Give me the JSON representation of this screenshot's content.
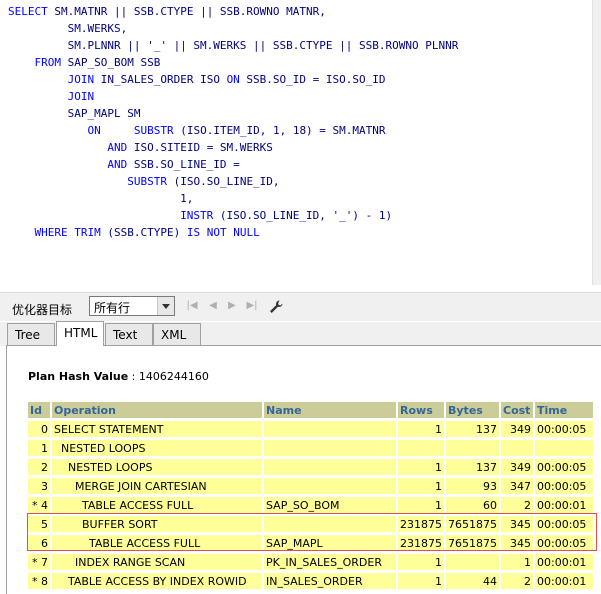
{
  "sql": {
    "lines": [
      {
        "segments": [
          {
            "t": "SELECT",
            "c": "kw"
          },
          {
            "t": " SM.MATNR || SSB.CTYPE || SSB.ROWNO MATNR,",
            "c": "lit"
          }
        ]
      },
      {
        "segments": [
          {
            "t": "         SM.WERKS,",
            "c": "lit"
          }
        ]
      },
      {
        "segments": [
          {
            "t": "         SM.PLNNR || '_' || SM.WERKS || SSB.CTYPE || SSB.ROWNO PLNNR",
            "c": "lit"
          }
        ]
      },
      {
        "segments": [
          {
            "t": "    ",
            "c": "lit"
          },
          {
            "t": "FROM",
            "c": "kw"
          },
          {
            "t": " SAP_SO_BOM SSB",
            "c": "lit"
          }
        ]
      },
      {
        "segments": [
          {
            "t": "         ",
            "c": "lit"
          },
          {
            "t": "JOIN",
            "c": "kw"
          },
          {
            "t": " IN_SALES_ORDER ISO ",
            "c": "lit"
          },
          {
            "t": "ON",
            "c": "kw"
          },
          {
            "t": " SSB.SO_ID = ISO.SO_ID",
            "c": "lit"
          }
        ]
      },
      {
        "segments": [
          {
            "t": "         ",
            "c": "lit"
          },
          {
            "t": "JOIN",
            "c": "kw"
          }
        ]
      },
      {
        "segments": [
          {
            "t": "         SAP_MAPL SM",
            "c": "lit"
          }
        ]
      },
      {
        "segments": [
          {
            "t": "            ",
            "c": "lit"
          },
          {
            "t": "ON",
            "c": "kw"
          },
          {
            "t": "     ",
            "c": "lit"
          },
          {
            "t": "SUBSTR",
            "c": "fn"
          },
          {
            "t": " (ISO.ITEM_ID, 1, 18) = SM.MATNR",
            "c": "lit"
          }
        ]
      },
      {
        "segments": [
          {
            "t": "               ",
            "c": "lit"
          },
          {
            "t": "AND",
            "c": "kw"
          },
          {
            "t": " ISO.SITEID = SM.WERKS",
            "c": "lit"
          }
        ]
      },
      {
        "segments": [
          {
            "t": "               ",
            "c": "lit"
          },
          {
            "t": "AND",
            "c": "kw"
          },
          {
            "t": " SSB.SO_LINE_ID =",
            "c": "lit"
          }
        ]
      },
      {
        "segments": [
          {
            "t": "                  ",
            "c": "lit"
          },
          {
            "t": "SUBSTR",
            "c": "fn"
          },
          {
            "t": " (ISO.SO_LINE_ID,",
            "c": "lit"
          }
        ]
      },
      {
        "segments": [
          {
            "t": "                          1,",
            "c": "lit"
          }
        ]
      },
      {
        "segments": [
          {
            "t": "                          ",
            "c": "lit"
          },
          {
            "t": "INSTR",
            "c": "fn"
          },
          {
            "t": " (ISO.SO_LINE_ID, '_') - 1)",
            "c": "lit"
          }
        ]
      },
      {
        "segments": [
          {
            "t": "    ",
            "c": "lit"
          },
          {
            "t": "WHERE",
            "c": "kw"
          },
          {
            "t": " ",
            "c": "lit"
          },
          {
            "t": "TRIM",
            "c": "fn"
          },
          {
            "t": " (SSB.CTYPE) ",
            "c": "lit"
          },
          {
            "t": "IS NOT NULL",
            "c": "kw"
          }
        ]
      }
    ]
  },
  "toolbar": {
    "goal_label": "优化器目标",
    "goal_value": "所有行",
    "nav_icons": [
      "first-icon",
      "prev-icon",
      "next-icon",
      "last-icon"
    ]
  },
  "tabs": [
    {
      "label": "Tree",
      "active": false
    },
    {
      "label": "HTML",
      "active": true
    },
    {
      "label": "Text",
      "active": false
    },
    {
      "label": "XML",
      "active": false
    }
  ],
  "plan": {
    "hash_label": "Plan Hash Value",
    "hash_value": " : 1406244160",
    "headers": [
      "Id",
      "Operation",
      "Name",
      "Rows",
      "Bytes",
      "Cost",
      "Time"
    ],
    "rows": [
      {
        "id": "0",
        "op": "SELECT STATEMENT",
        "name": "",
        "rows": "1",
        "bytes": "137",
        "cost": "349",
        "time": "00:00:05"
      },
      {
        "id": "1",
        "op": "  NESTED LOOPS",
        "name": "",
        "rows": "",
        "bytes": "",
        "cost": "",
        "time": ""
      },
      {
        "id": "2",
        "op": "    NESTED LOOPS",
        "name": "",
        "rows": "1",
        "bytes": "137",
        "cost": "349",
        "time": "00:00:05"
      },
      {
        "id": "3",
        "op": "      MERGE JOIN CARTESIAN",
        "name": "",
        "rows": "1",
        "bytes": "93",
        "cost": "347",
        "time": "00:00:05"
      },
      {
        "id": "* 4",
        "op": "        TABLE ACCESS FULL",
        "name": "SAP_SO_BOM",
        "rows": "1",
        "bytes": "60",
        "cost": "2",
        "time": "00:00:01"
      },
      {
        "id": "5",
        "op": "        BUFFER SORT",
        "name": "",
        "rows": "231875",
        "bytes": "7651875",
        "cost": "345",
        "time": "00:00:05"
      },
      {
        "id": "6",
        "op": "          TABLE ACCESS FULL",
        "name": "SAP_MAPL",
        "rows": "231875",
        "bytes": "7651875",
        "cost": "345",
        "time": "00:00:05"
      },
      {
        "id": "* 7",
        "op": "      INDEX RANGE SCAN",
        "name": "PK_IN_SALES_ORDER",
        "rows": "1",
        "bytes": "",
        "cost": "1",
        "time": "00:00:01"
      },
      {
        "id": "* 8",
        "op": "    TABLE ACCESS BY INDEX ROWID",
        "name": "IN_SALES_ORDER",
        "rows": "1",
        "bytes": "44",
        "cost": "2",
        "time": "00:00:01"
      }
    ]
  }
}
